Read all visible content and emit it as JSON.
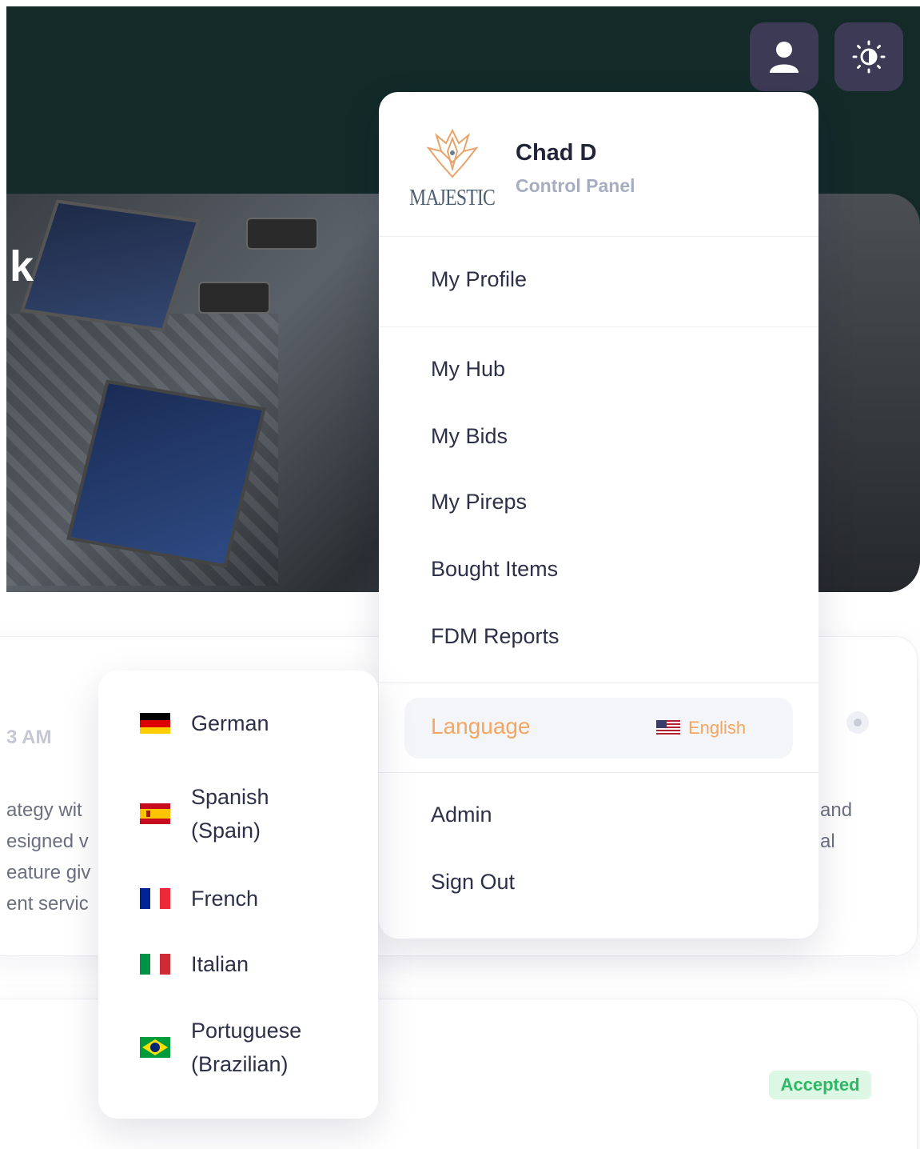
{
  "header": {
    "user_button_icon": "user-icon",
    "theme_button_icon": "sun-icon"
  },
  "hero": {
    "fragment_letter": "k"
  },
  "background_card": {
    "time_fragment": "3 AM",
    "left_fragment": "ategy wit\nesigned v\neature giv\nent servic",
    "right_fragment": "and\nal",
    "eye_icon": "eye-icon"
  },
  "status": {
    "badge": "Accepted",
    "color": "#2eb765"
  },
  "user_menu": {
    "logo_text": "MAJESTIC",
    "user_name": "Chad D",
    "subtitle": "Control Panel",
    "items": {
      "profile": "My Profile",
      "hub": "My Hub",
      "bids": "My Bids",
      "pireps": "My Pireps",
      "bought": "Bought Items",
      "fdm": "FDM Reports",
      "admin": "Admin",
      "signout": "Sign Out"
    },
    "language": {
      "label": "Language",
      "current": "English",
      "accent_color": "#f3a660"
    }
  },
  "language_menu": {
    "options": [
      {
        "label": "German",
        "flag": "de"
      },
      {
        "label": "Spanish\n(Spain)",
        "flag": "es"
      },
      {
        "label": "French",
        "flag": "fr"
      },
      {
        "label": "Italian",
        "flag": "it"
      },
      {
        "label": "Portuguese\n(Brazilian)",
        "flag": "br"
      }
    ]
  }
}
